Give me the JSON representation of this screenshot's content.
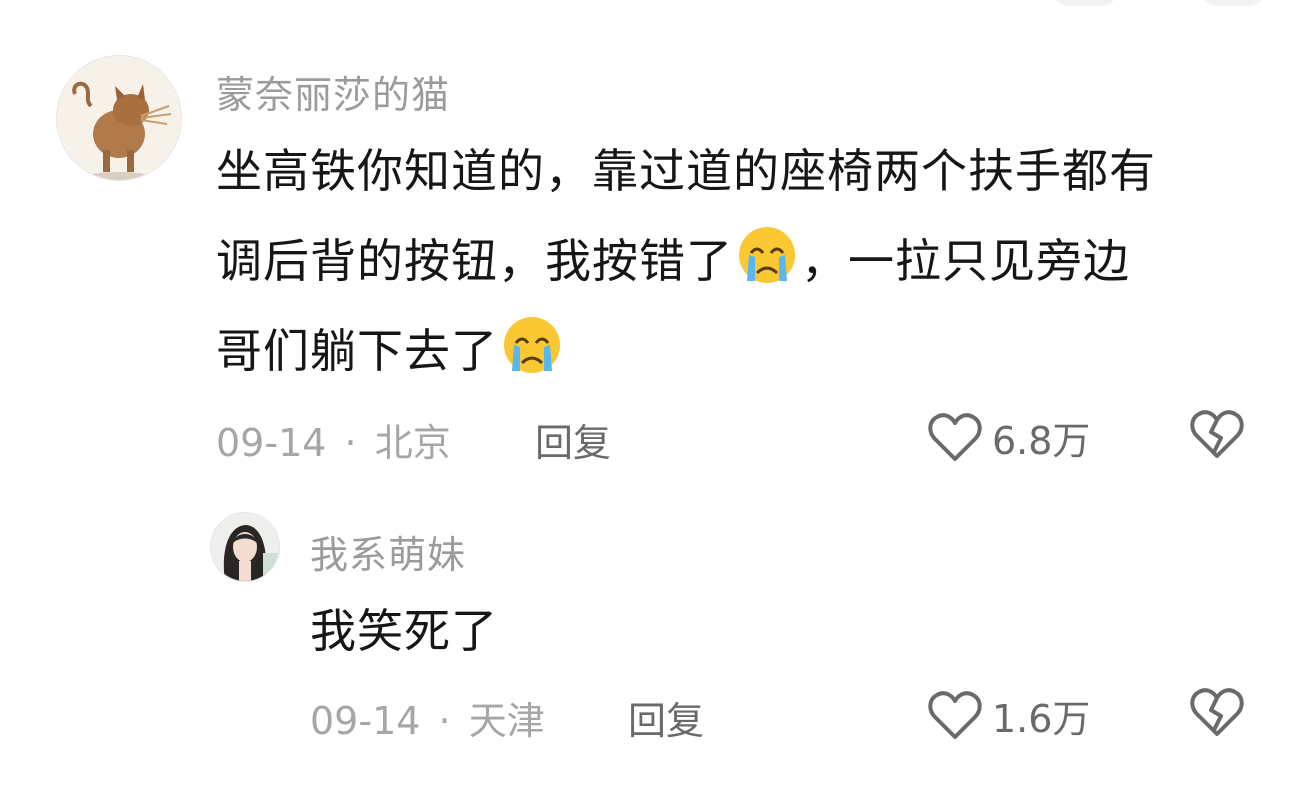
{
  "comments": [
    {
      "username": "蒙奈丽莎的猫",
      "avatar_icon": "cat-sculpture-avatar",
      "text_lines": [
        "坐高铁你知道的，靠过道的座椅两个扶手都有",
        "调后背的按钮，我按错了",
        "，一拉只见旁边",
        "哥们躺下去了"
      ],
      "emoji": "crying-face",
      "date": "09-14",
      "separator": "·",
      "location": "北京",
      "reply_label": "回复",
      "like_count": "6.8万"
    },
    {
      "username": "我系萌妹",
      "avatar_icon": "girl-photo-avatar",
      "text": "我笑死了",
      "date": "09-14",
      "separator": "·",
      "location": "天津",
      "reply_label": "回复",
      "like_count": "1.6万"
    }
  ],
  "colors": {
    "username": "#9b9b9b",
    "text": "#161616",
    "meta": "#a6a6a6",
    "action": "#6a6a6a"
  }
}
